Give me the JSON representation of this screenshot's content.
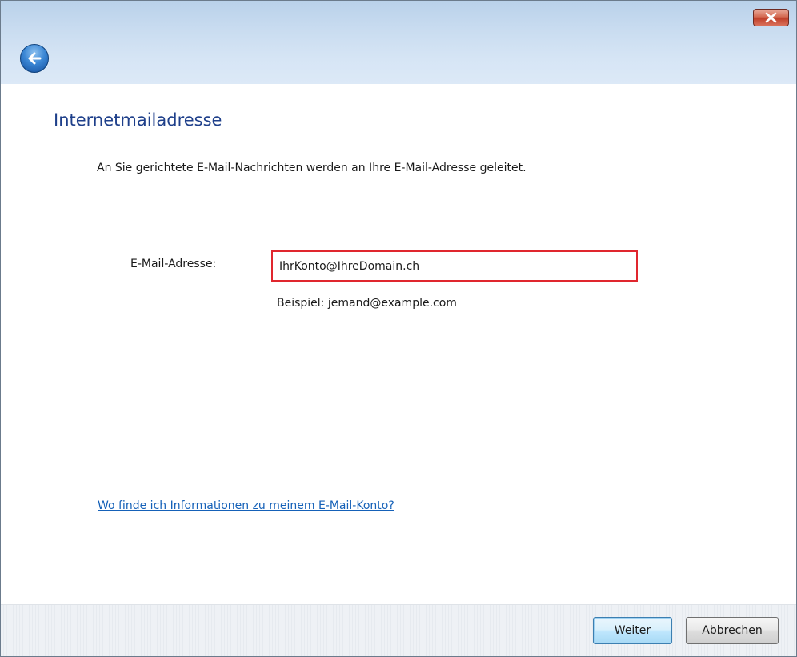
{
  "titlebar": {
    "close_icon": "close-icon",
    "back_icon": "back-arrow-icon"
  },
  "main": {
    "heading": "Internetmailadresse",
    "intro": "An Sie gerichtete E-Mail-Nachrichten werden an Ihre E-Mail-Adresse geleitet.",
    "email_label": "E-Mail-Adresse:",
    "email_value": "IhrKonto@IhreDomain.ch",
    "email_example": "Beispiel: jemand@example.com",
    "help_link": "Wo finde ich Informationen zu meinem E-Mail-Konto?"
  },
  "footer": {
    "next_label": "Weiter",
    "cancel_label": "Abbrechen"
  },
  "colors": {
    "heading": "#1e3f8a",
    "link": "#1561b8",
    "highlight_border": "#e0262e",
    "titlebar": "#c9dcf0"
  }
}
